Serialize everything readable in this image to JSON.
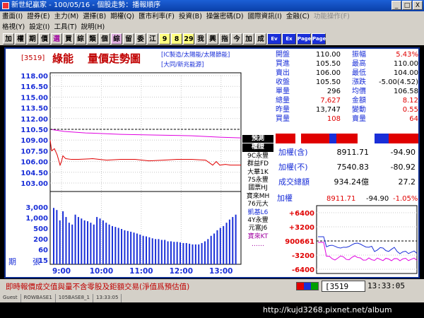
{
  "window": {
    "title": "新世紀贏家 - 100/05/16 - 個股走勢：播報順序",
    "buttons": [
      "_",
      "□",
      "X"
    ]
  },
  "menu": {
    "row1": [
      "畫面(I)",
      "證券(E)",
      "主力(M)",
      "選擇(B)",
      "期權(Q)",
      "匯市利率(F)",
      "投資(B)",
      "操盤密碼(D)",
      "國際資訊(I)",
      "金融(C)",
      "功能操作(F)"
    ],
    "row2": [
      "格視(Y)",
      "設定(I)",
      "工具(T)",
      "說明(H)"
    ]
  },
  "toolbar": {
    "buttons": [
      "加",
      "權",
      "期",
      "價",
      "選",
      "買",
      "綜",
      "類",
      "個",
      "綜",
      "留",
      "委",
      "江",
      "9",
      "8",
      "29",
      "我",
      "興",
      "指",
      "今",
      "加",
      "成",
      "Ev",
      "Ex",
      "Page",
      "Page"
    ]
  },
  "stock": {
    "code": "[3519]",
    "name": "綠能",
    "view": "量價走勢圖",
    "tags1": "[IC製造/太陽能/太陽節能]",
    "tags2": "[大同/新兆能源]"
  },
  "quote": {
    "rows": [
      {
        "k1": "開盤",
        "v1": "110.00",
        "k2": "振幅",
        "v2": "5.43%",
        "c1": "",
        "c2": "red"
      },
      {
        "k1": "買進",
        "v1": "105.50",
        "k2": "最高",
        "v2": "110.00",
        "c1": "",
        "c2": ""
      },
      {
        "k1": "賣出",
        "v1": "106.00",
        "k2": "最低",
        "v2": "104.00",
        "c1": "",
        "c2": ""
      },
      {
        "k1": "收盤",
        "v1": "105.50",
        "k2": "漲跌",
        "v2": "-5.00(4.52)",
        "c1": "",
        "c2": ""
      },
      {
        "k1": "單量",
        "v1": "296",
        "k2": "均價",
        "v2": "106.58",
        "c1": "",
        "c2": ""
      },
      {
        "k1": "總量",
        "v1": "7,627",
        "k2": "金額",
        "v2": "8.12",
        "c1": "red",
        "c2": "red"
      },
      {
        "k1": "昨量",
        "v1": "13,747",
        "k2": "變動",
        "v2": "0.55",
        "c1": "",
        "c2": "red"
      },
      {
        "k1": "買量",
        "v1": "108",
        "k2": "賣量",
        "v2": "64",
        "c1": "red",
        "c2": "red"
      }
    ]
  },
  "index_summary": {
    "rows": [
      {
        "k": "加權(含)",
        "v": "8911.71",
        "c": "-94.90"
      },
      {
        "k": "加權(不)",
        "v": "7540.83",
        "c": "-80.92"
      },
      {
        "k": "成交總額",
        "v": "934.24億",
        "c": "27.2"
      }
    ]
  },
  "index_chart": {
    "title": "加權",
    "value": "8911.71",
    "change": "-94.90",
    "pct": "-1.05%",
    "yticks": [
      "+6400",
      "+3200",
      "900661",
      "-3200",
      "-6400"
    ]
  },
  "brokers": {
    "header1": "預測",
    "header2": "權證",
    "items": [
      "9C永豐",
      "群益FD",
      "大華1K",
      "7S永豐",
      "國票HJ",
      "寶來MH",
      "76元大",
      "凱基L6",
      "4Y永豐",
      "元富J6",
      "寶來KT",
      "‥‥‥"
    ]
  },
  "chart_data": {
    "type": "line",
    "title": "量價走勢圖",
    "xlabel": "",
    "ylabel": "",
    "x_ticks": [
      "9:00",
      "10:00",
      "11:00",
      "12:00",
      "13:00"
    ],
    "price_ticks": [
      "118.00",
      "116.50",
      "115.00",
      "113.50",
      "112.00",
      "110.50",
      "109.00",
      "107.50",
      "106.00",
      "104.50",
      "103.00"
    ],
    "volume_ticks": [
      "3,000",
      "1,000",
      "500",
      "200",
      "60",
      "15"
    ],
    "volume_label": "張",
    "period_label": "期",
    "ylim": [
      103,
      118
    ],
    "reference_price": 110.5,
    "series": [
      {
        "name": "價",
        "color": "#e00000",
        "points": [
          [
            0,
            109.0
          ],
          [
            2,
            107.5
          ],
          [
            6,
            107.8
          ],
          [
            10,
            106.9
          ],
          [
            14,
            105.5
          ],
          [
            16,
            106.0
          ],
          [
            18,
            106.8
          ],
          [
            22,
            106.4
          ],
          [
            30,
            106.3
          ],
          [
            40,
            106.3
          ],
          [
            60,
            106.4
          ],
          [
            80,
            106.2
          ],
          [
            100,
            106.3
          ],
          [
            120,
            106.3
          ],
          [
            140,
            106.1
          ],
          [
            160,
            106.2
          ],
          [
            180,
            106.3
          ],
          [
            200,
            106.3
          ],
          [
            220,
            106.2
          ],
          [
            230,
            105.5
          ],
          [
            235,
            106.0
          ],
          [
            240,
            105.5
          ],
          [
            248,
            105.6
          ],
          [
            255,
            105.5
          ],
          [
            270,
            105.5
          ]
        ]
      },
      {
        "name": "均價",
        "color": "#e000e0",
        "points": [
          [
            0,
            110.5
          ],
          [
            20,
            110.2
          ],
          [
            50,
            110.0
          ],
          [
            100,
            109.8
          ],
          [
            150,
            109.7
          ],
          [
            200,
            109.6
          ],
          [
            240,
            109.4
          ],
          [
            270,
            109.3
          ]
        ]
      }
    ],
    "volumes": [
      900,
      700,
      200,
      600,
      300,
      150,
      120,
      400,
      300,
      250,
      200,
      180,
      150,
      120,
      300,
      250,
      200,
      150,
      120,
      100,
      90,
      80,
      70,
      60,
      55,
      50,
      45,
      40,
      35,
      30,
      28,
      25,
      22,
      20,
      20,
      18,
      18,
      15,
      15,
      14,
      14,
      13,
      12,
      12,
      11,
      10,
      10,
      10,
      12,
      15,
      20,
      30,
      40,
      60,
      80,
      100,
      150,
      220,
      300,
      400
    ]
  },
  "status": {
    "message": "即時報價成交值與量不含零股及鉅額交易(淨值爲預估值)",
    "code": "[3519",
    "time": "13:33:05"
  },
  "taskbar": [
    "Guest",
    "ROWBASE1",
    "105BASE8_1",
    "13:33:05"
  ],
  "watermark": "http://kujd3268.pixnet.net/album"
}
